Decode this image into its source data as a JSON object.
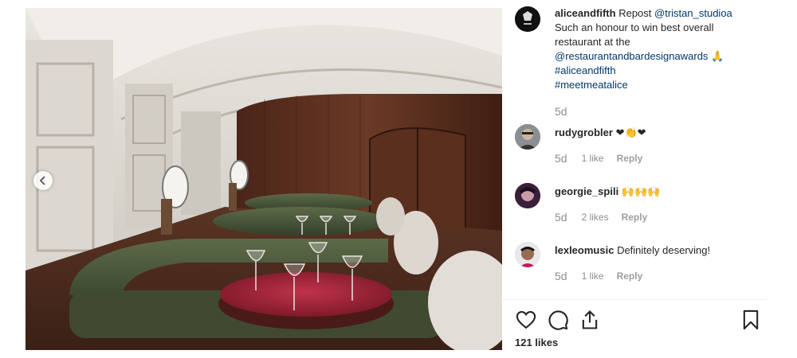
{
  "post": {
    "author": "aliceandfifth",
    "caption_prefix": "Repost",
    "repost_handle": "@tristan_studioa",
    "caption_line1": "Such an honour to win best overall",
    "caption_line2": "restaurant at the",
    "award_handle": "@restaurantandbardesignawards",
    "caption_emoji": "🙏",
    "hashtag1": "#aliceandfifth",
    "hashtag2": "#meetmeatalice",
    "time": "5d"
  },
  "comments": [
    {
      "user": "rudygrobler",
      "text": "",
      "emoji": "❤👏❤",
      "time": "5d",
      "likes": "1 like",
      "reply": "Reply"
    },
    {
      "user": "georgie_spili",
      "text": "",
      "emoji": "🙌🙌🙌",
      "time": "5d",
      "likes": "2 likes",
      "reply": "Reply"
    },
    {
      "user": "lexleomusic",
      "text": "Definitely deserving!",
      "emoji": "",
      "time": "5d",
      "likes": "1 like",
      "reply": "Reply"
    }
  ],
  "footer": {
    "likes_count": "121 likes"
  },
  "icons": {
    "like": "heart-icon",
    "comment": "comment-icon",
    "share": "share-icon",
    "save": "bookmark-icon",
    "prev": "chevron-left-icon"
  },
  "colors": {
    "link": "#00376b",
    "text": "#262626",
    "muted": "#8e8e8e",
    "heart": "#ed4956"
  }
}
